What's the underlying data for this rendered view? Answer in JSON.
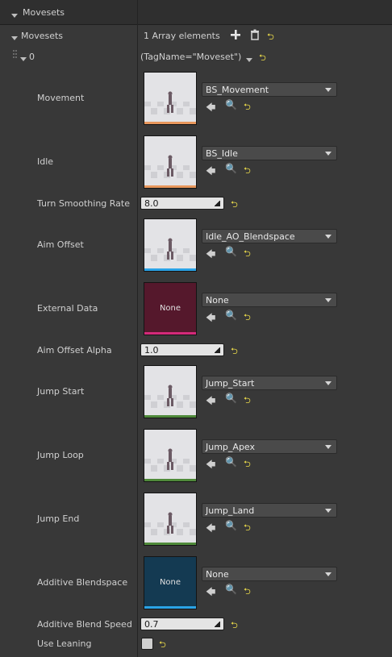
{
  "header": {
    "title": "Movesets"
  },
  "array": {
    "label": "Movesets",
    "count_text": "1 Array elements"
  },
  "element": {
    "index": "0",
    "value": "(TagName=\"Moveset\")"
  },
  "rows": {
    "movement": {
      "label": "Movement",
      "asset": "BS_Movement"
    },
    "idle": {
      "label": "Idle",
      "asset": "BS_Idle"
    },
    "turn": {
      "label": "Turn Smoothing Rate",
      "value": "8.0"
    },
    "aim": {
      "label": "Aim Offset",
      "asset": "Idle_AO_Blendspace"
    },
    "external": {
      "label": "External Data",
      "asset": "None",
      "thumb_text": "None"
    },
    "aim_alpha": {
      "label": "Aim Offset Alpha",
      "value": "1.0"
    },
    "jump_start": {
      "label": "Jump Start",
      "asset": "Jump_Start"
    },
    "jump_loop": {
      "label": "Jump Loop",
      "asset": "Jump_Apex"
    },
    "jump_end": {
      "label": "Jump End",
      "asset": "Jump_Land"
    },
    "additive": {
      "label": "Additive Blendspace",
      "asset": "None",
      "thumb_text": "None"
    },
    "add_speed": {
      "label": "Additive Blend Speed",
      "value": "0.7"
    },
    "leaning": {
      "label": "Use Leaning",
      "checked": false
    }
  },
  "colors": {
    "blendspace": "#e8975c",
    "aimoffset": "#2aa3e6",
    "data": "#d42a7a",
    "anim": "#4f8a3a",
    "reset": "#e8d84a"
  }
}
